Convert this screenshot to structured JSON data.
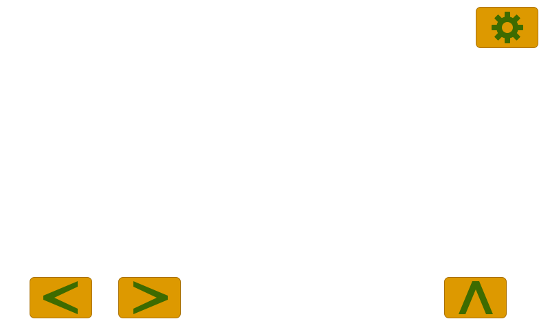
{
  "colors": {
    "button_fill": "#dd9900",
    "button_border": "#a86f00",
    "icon": "#3d6b00",
    "background": "#ffffff"
  },
  "controls": {
    "settings": {
      "icon": "gear-icon"
    },
    "previous": {
      "icon": "chevron-left-icon"
    },
    "next": {
      "icon": "chevron-right-icon"
    },
    "up": {
      "icon": "chevron-up-icon"
    }
  }
}
